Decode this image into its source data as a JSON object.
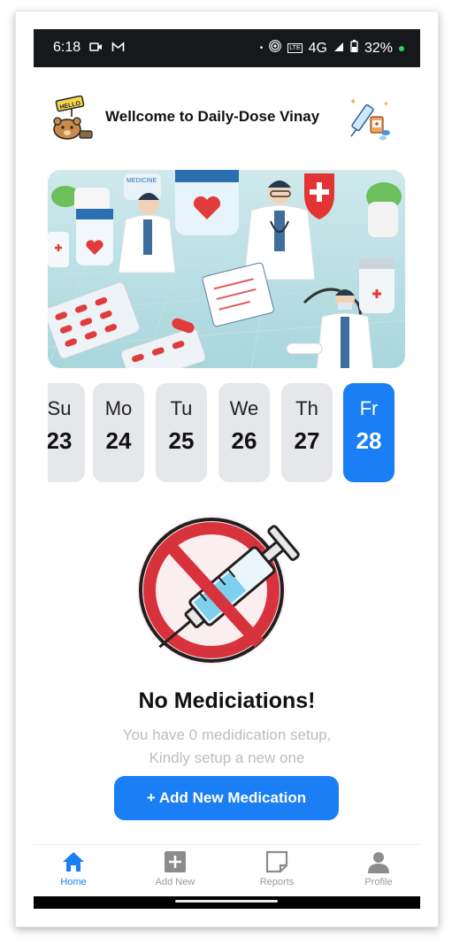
{
  "status_bar": {
    "time": "6:18",
    "network": "4G",
    "battery": "32%",
    "lte_badge": "LTE"
  },
  "header": {
    "title": "Wellcome to Daily-Dose Vinay",
    "hello_sign": "HELLO",
    "banner_label": "MEDICINE"
  },
  "dates": [
    {
      "day": "Su",
      "num": "23"
    },
    {
      "day": "Mo",
      "num": "24"
    },
    {
      "day": "Tu",
      "num": "25"
    },
    {
      "day": "We",
      "num": "26"
    },
    {
      "day": "Th",
      "num": "27"
    },
    {
      "day": "Fr",
      "num": "28"
    }
  ],
  "selected_date_index": 5,
  "empty_state": {
    "title": "No Mediciations!",
    "subtitle_line1": "You have 0 medidication setup,",
    "subtitle_line2": "Kindly setup a new one"
  },
  "add_button": {
    "label": "+ Add New Medication"
  },
  "tabs": [
    {
      "label": "Home",
      "icon": "home-icon"
    },
    {
      "label": "Add New",
      "icon": "plus-square-icon"
    },
    {
      "label": "Reports",
      "icon": "note-icon"
    },
    {
      "label": "Profile",
      "icon": "user-icon"
    }
  ],
  "active_tab": 0,
  "colors": {
    "accent": "#1a7ef5",
    "card_bg": "#e5e7ea",
    "status_bar": "#17181c",
    "muted_text": "#bdbdbd"
  }
}
